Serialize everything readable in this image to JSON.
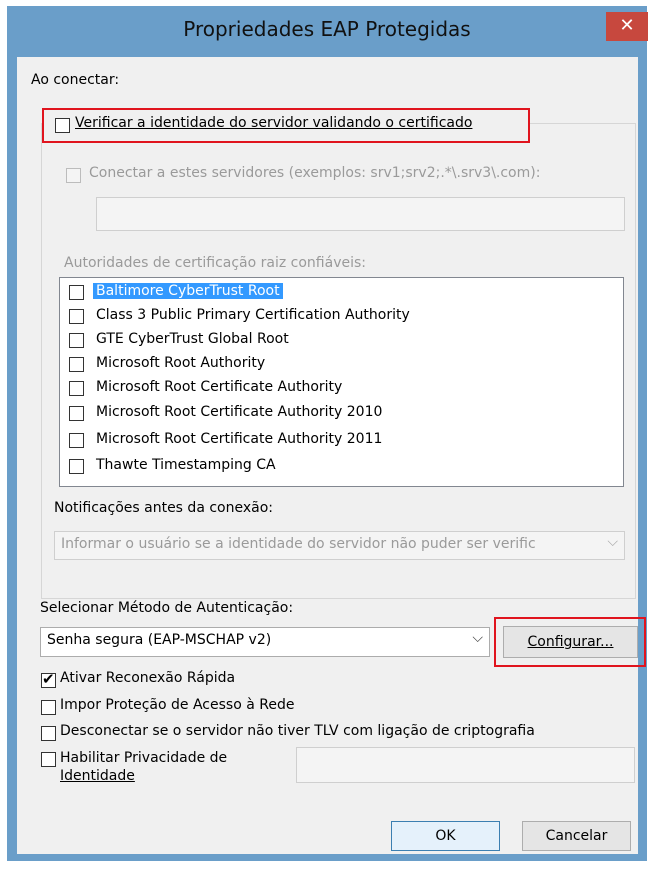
{
  "window": {
    "title": "Propriedades EAP Protegidas",
    "close_label": "✕"
  },
  "connect_section": {
    "label": "Ao conectar:",
    "verify_server_label": "Verificar a identidade do servidor validando o certificado",
    "verify_server_checked": false,
    "connect_servers_label": "Conectar a estes servidores (exemplos: srv1;srv2;.*\\.srv3\\.com):",
    "servers_value": "",
    "trusted_ca_label": "Autoridades de certificação raiz confiáveis:",
    "trusted_ca_items": [
      {
        "label": "Baltimore CyberTrust Root",
        "checked": false,
        "selected": true
      },
      {
        "label": "Class 3 Public Primary Certification Authority",
        "checked": false
      },
      {
        "label": "GTE CyberTrust Global Root",
        "checked": false
      },
      {
        "label": "Microsoft Root Authority",
        "checked": false
      },
      {
        "label": "Microsoft Root Certificate Authority",
        "checked": false
      },
      {
        "label": "Microsoft Root Certificate Authority 2010",
        "checked": false
      },
      {
        "label": "Microsoft Root Certificate Authority 2011",
        "checked": false
      },
      {
        "label": "Thawte Timestamping CA",
        "checked": false
      }
    ],
    "notifications_label": "Notificações antes da conexão:",
    "notifications_value": "Informar o usuário se a identidade do servidor não puder ser verific"
  },
  "auth_method": {
    "label": "Selecionar Método de Autenticação:",
    "value": "Senha segura (EAP-MSCHAP v2)",
    "configure_label": "Configurar..."
  },
  "options": [
    {
      "label": "Ativar Reconexão Rápida",
      "checked": true
    },
    {
      "label": "Impor Proteção de Acesso à Rede",
      "checked": false
    },
    {
      "label": "Desconectar se o servidor não tiver TLV com ligação de criptografia",
      "checked": false
    }
  ],
  "identity_privacy": {
    "label_line1": "Habilitar Privacidade de",
    "label_line2": "Identidade",
    "checked": false,
    "value": ""
  },
  "buttons": {
    "ok_label": "OK",
    "cancel_label": "Cancelar"
  },
  "colors": {
    "frame": "#6a9ec9",
    "close": "#c7483e",
    "highlight_outline": "#e0141e",
    "selection": "#3399ff"
  }
}
